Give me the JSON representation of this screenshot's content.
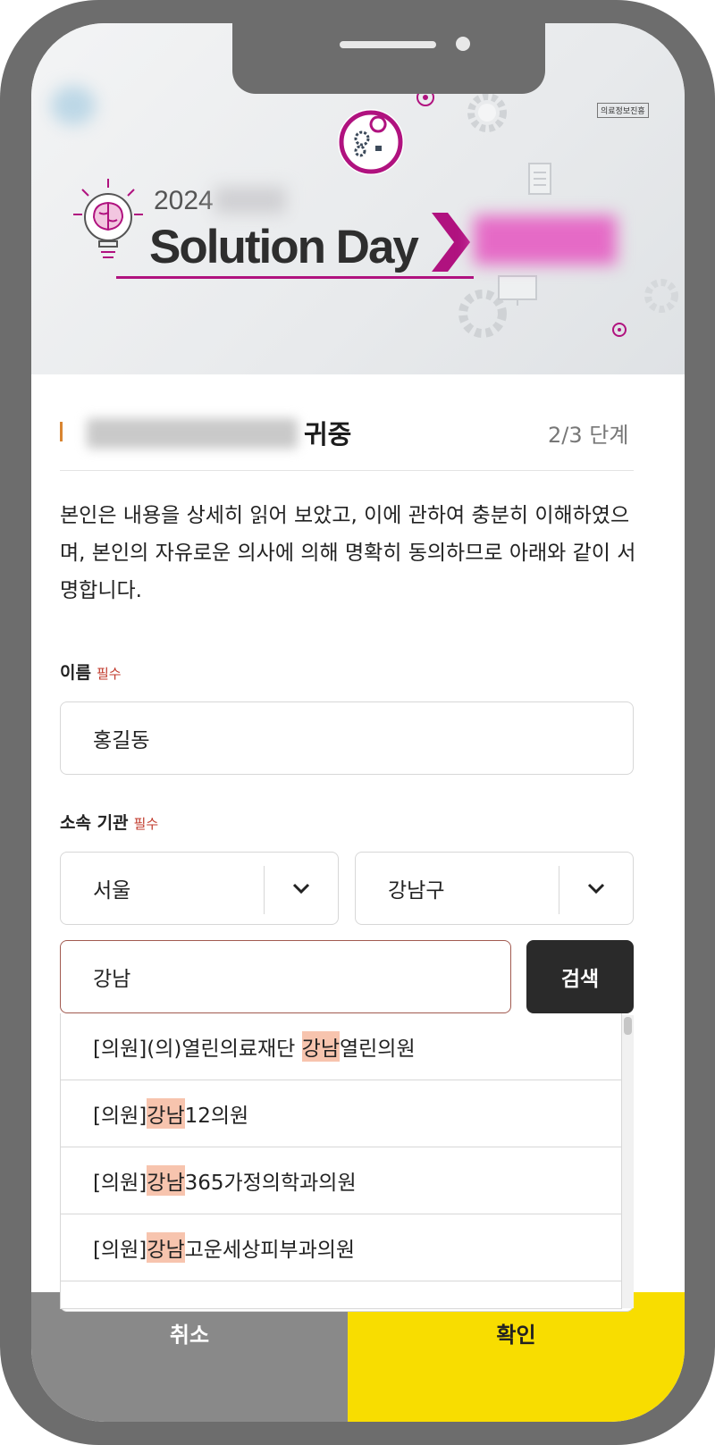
{
  "banner": {
    "year": "2024",
    "title": "Solution Day",
    "corner_logo": "의료정보진흥"
  },
  "form": {
    "section_title": "귀중",
    "step": "2/3 단계",
    "description": "본인은 내용을 상세히 읽어 보았고, 이에 관하여 충분히 이해하였으며, 본인의 자유로운 의사에 의해 명확히 동의하므로 아래와 같이 서명합니다.",
    "name_label": "이름",
    "name_required": "필수",
    "name_value": "홍길동",
    "org_label": "소속 기관",
    "org_required": "필수",
    "city_value": "서울",
    "district_value": "강남구",
    "search_value": "강남",
    "search_button": "검색"
  },
  "results": [
    {
      "prefix": "[의원](의)열린의료재단 ",
      "match": "강남",
      "suffix": "열린의원"
    },
    {
      "prefix": "[의원]",
      "match": "강남",
      "suffix": "12의원"
    },
    {
      "prefix": "[의원]",
      "match": "강남",
      "suffix": "365가정의학과의원"
    },
    {
      "prefix": "[의원]",
      "match": "강남",
      "suffix": "고운세상피부과의원"
    }
  ],
  "footer": {
    "cancel": "취소",
    "confirm": "확인"
  },
  "colors": {
    "accent_magenta": "#b0127f",
    "confirm_yellow": "#f8dd00",
    "highlight": "#f7c4ae"
  }
}
